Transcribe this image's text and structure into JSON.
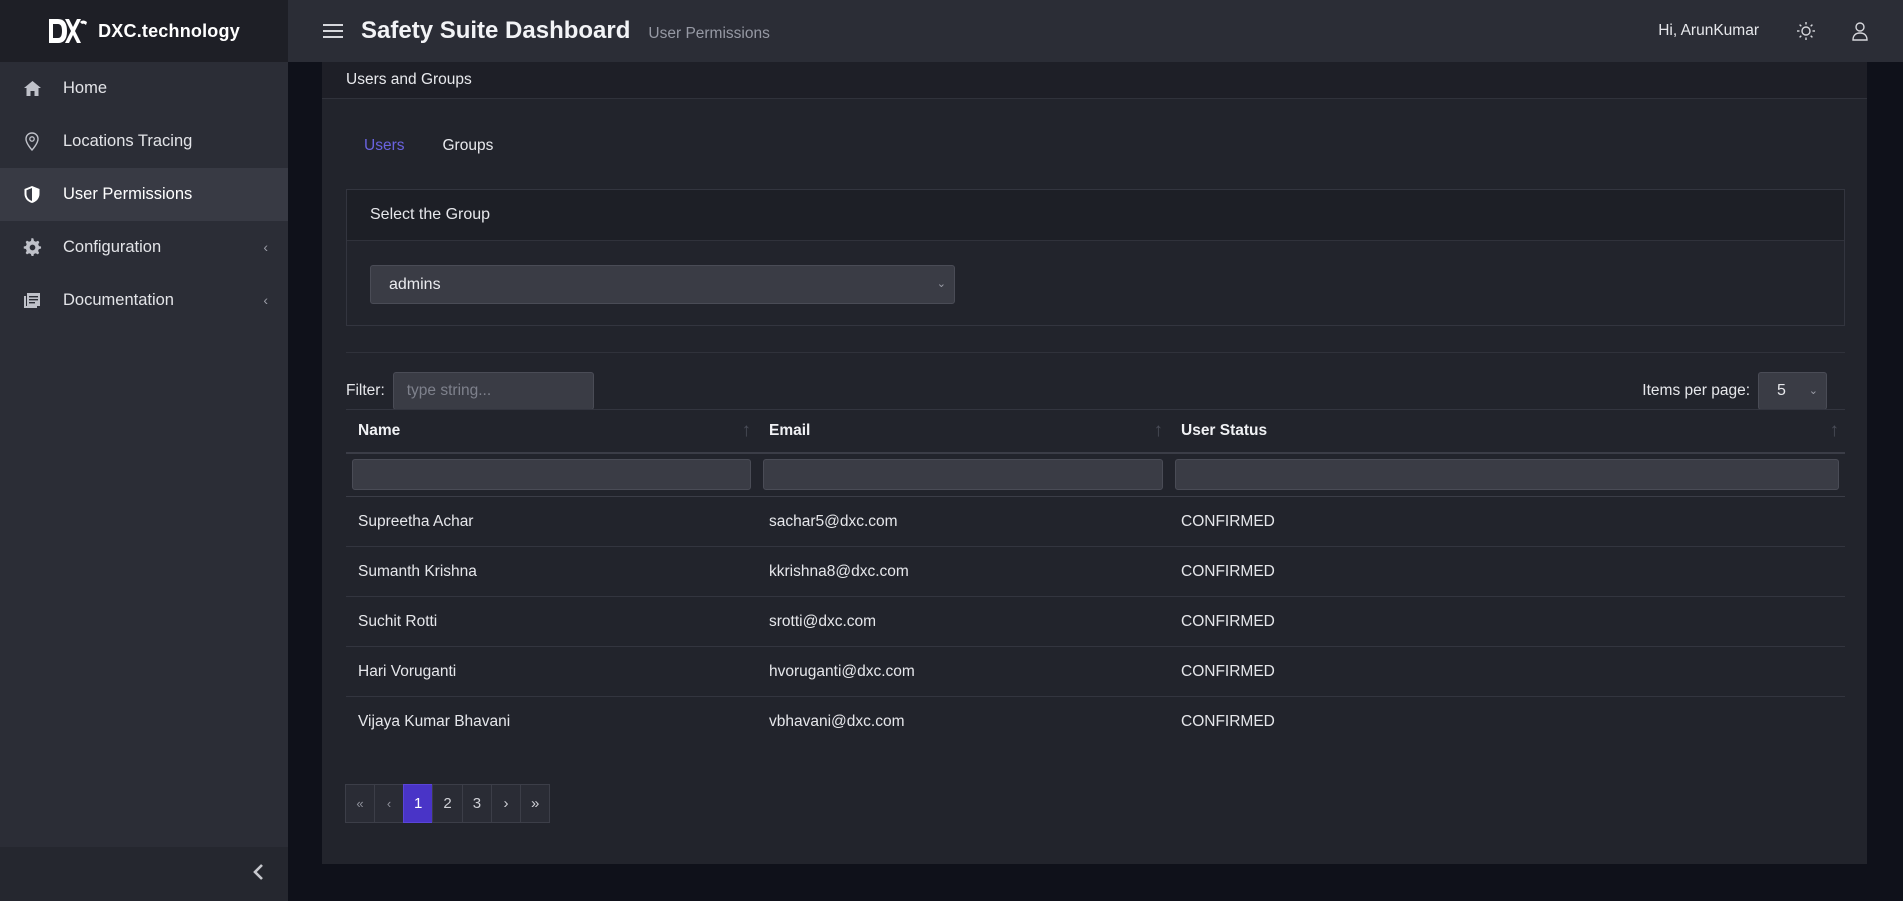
{
  "brand": {
    "name": "DXC.technology"
  },
  "sidebar": {
    "items": [
      {
        "label": "Home",
        "icon": "home-icon",
        "active": false,
        "expandable": false
      },
      {
        "label": "Locations Tracing",
        "icon": "location-pin-icon",
        "active": false,
        "expandable": false
      },
      {
        "label": "User Permissions",
        "icon": "shield-icon",
        "active": true,
        "expandable": false
      },
      {
        "label": "Configuration",
        "icon": "gear-icon",
        "active": false,
        "expandable": true
      },
      {
        "label": "Documentation",
        "icon": "document-icon",
        "active": false,
        "expandable": true
      }
    ],
    "chevron": "‹",
    "collapse_glyph": "‹"
  },
  "header": {
    "title": "Safety Suite Dashboard",
    "breadcrumb": "User Permissions",
    "greeting": "Hi, ArunKumar",
    "icons": [
      "hamburger-icon",
      "sun-icon",
      "user-icon"
    ]
  },
  "panel": {
    "title": "Users and Groups",
    "tabs": [
      {
        "label": "Users",
        "active": true
      },
      {
        "label": "Groups",
        "active": false
      }
    ],
    "group_box_title": "Select the Group",
    "group_select_value": "admins",
    "caret": "⌄"
  },
  "table_controls": {
    "filter_label": "Filter:",
    "filter_placeholder": "type string...",
    "items_per_page_label": "Items per page:",
    "items_per_page_value": "5"
  },
  "table": {
    "headers": [
      "Name",
      "Email",
      "User Status"
    ],
    "sort_glyph": "↑",
    "rows": [
      {
        "name": "Supreetha Achar",
        "email": "sachar5@dxc.com",
        "status": "CONFIRMED"
      },
      {
        "name": "Sumanth Krishna",
        "email": "kkrishna8@dxc.com",
        "status": "CONFIRMED"
      },
      {
        "name": "Suchit Rotti",
        "email": "srotti@dxc.com",
        "status": "CONFIRMED"
      },
      {
        "name": "Hari Voruganti",
        "email": "hvoruganti@dxc.com",
        "status": "CONFIRMED"
      },
      {
        "name": "Vijaya Kumar Bhavani",
        "email": "vbhavani@dxc.com",
        "status": "CONFIRMED"
      }
    ]
  },
  "pagination": {
    "first": "«",
    "prev": "‹",
    "pages": [
      "1",
      "2",
      "3"
    ],
    "current": "1",
    "next": "›",
    "last": "»"
  },
  "colors": {
    "accent": "#4934c7",
    "tab_active": "#6a63e0",
    "sidebar_bg": "#2b2d36",
    "page_bg": "#0f111a"
  }
}
